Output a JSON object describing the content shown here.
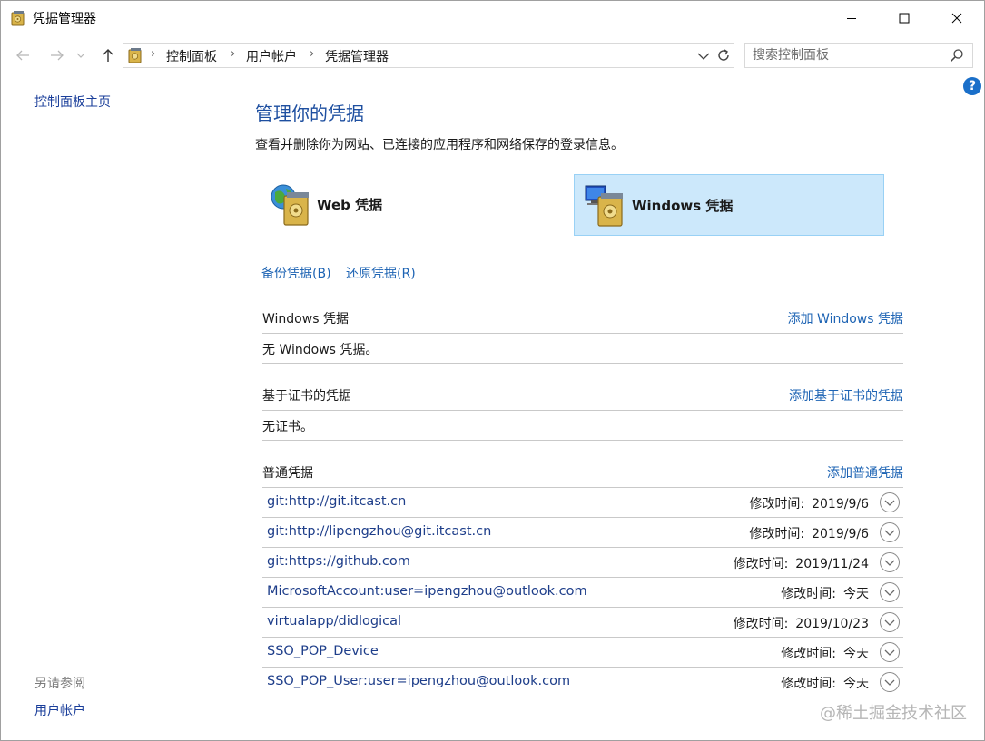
{
  "window": {
    "title": "凭据管理器"
  },
  "address_bar": {
    "crumbs": [
      "控制面板",
      "用户帐户",
      "凭据管理器"
    ],
    "search_placeholder": "搜索控制面板"
  },
  "left_pane": {
    "home_link": "控制面板主页",
    "see_also_label": "另请参阅",
    "see_also_links": [
      "用户帐户"
    ]
  },
  "main": {
    "title": "管理你的凭据",
    "description": "查看并删除你为网站、已连接的应用程序和网络保存的登录信息。",
    "tiles": [
      {
        "label": "Web 凭据",
        "selected": false
      },
      {
        "label": "Windows 凭据",
        "selected": true
      }
    ],
    "backup_link": "备份凭据(B)",
    "restore_link": "还原凭据(R)",
    "windows_section": {
      "title": "Windows 凭据",
      "add_link": "添加 Windows 凭据",
      "empty_text": "无 Windows 凭据。"
    },
    "cert_section": {
      "title": "基于证书的凭据",
      "add_link": "添加基于证书的凭据",
      "empty_text": "无证书。"
    },
    "generic_section": {
      "title": "普通凭据",
      "add_link": "添加普通凭据",
      "modified_label": "修改时间:",
      "items": [
        {
          "name": "git:http://git.itcast.cn",
          "modified": "2019/9/6"
        },
        {
          "name": "git:http://lipengzhou@git.itcast.cn",
          "modified": "2019/9/6"
        },
        {
          "name": "git:https://github.com",
          "modified": "2019/11/24"
        },
        {
          "name": "MicrosoftAccount:user=ipengzhou@outlook.com",
          "modified": "今天"
        },
        {
          "name": "virtualapp/didlogical",
          "modified": "2019/10/23"
        },
        {
          "name": "SSO_POP_Device",
          "modified": "今天"
        },
        {
          "name": "SSO_POP_User:user=ipengzhou@outlook.com",
          "modified": "今天"
        }
      ]
    }
  },
  "watermark": "@稀土掘金技术社区",
  "colors": {
    "link": "#1e64b4",
    "title": "#1e4fa0",
    "selected_tile": "#cce8fb",
    "help": "#1a6fc9"
  }
}
